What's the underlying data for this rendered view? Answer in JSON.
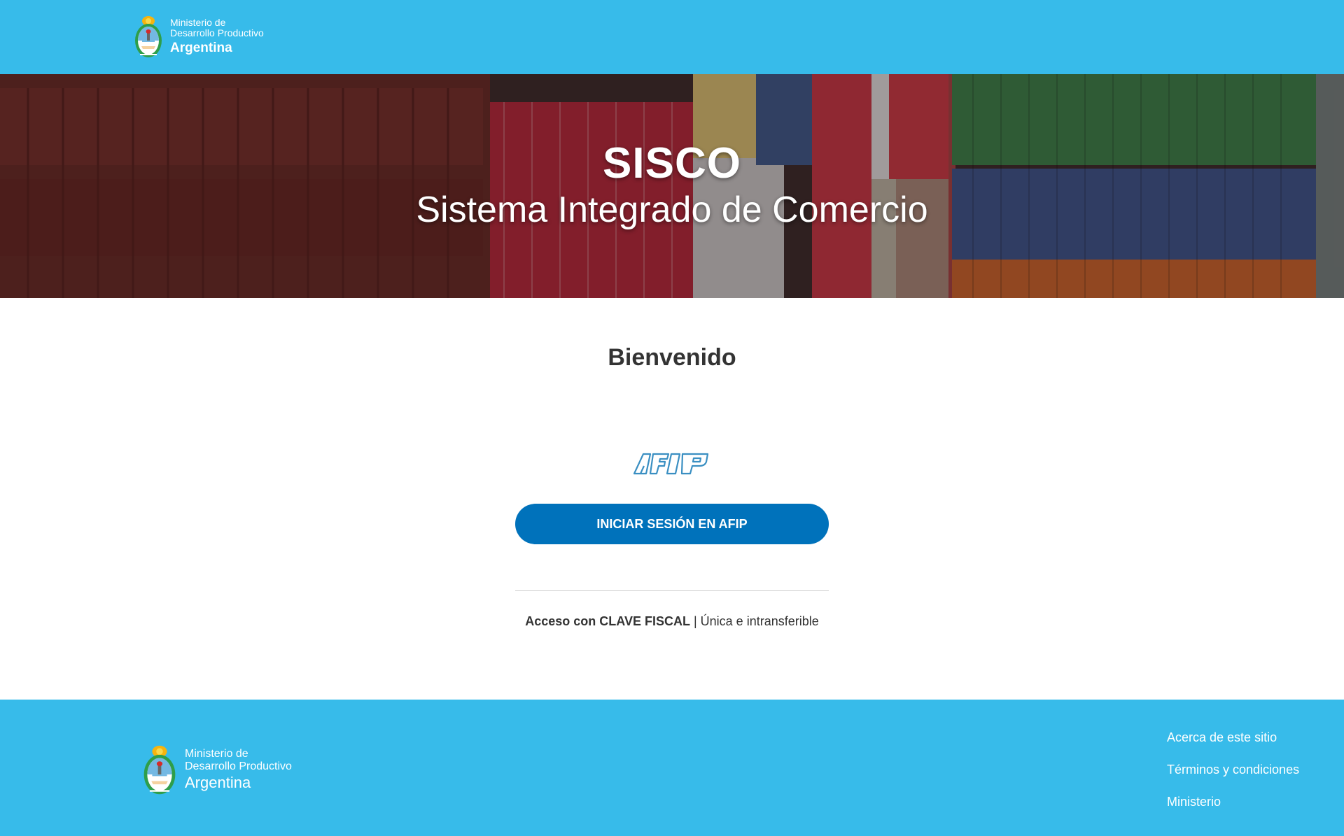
{
  "header": {
    "brand": {
      "line1": "Ministerio de",
      "line2": "Desarrollo Productivo",
      "line3": "Argentina"
    }
  },
  "hero": {
    "title": "SISCO",
    "subtitle": "Sistema Integrado de Comercio"
  },
  "main": {
    "welcome": "Bienvenido",
    "logo_label": "AFIP",
    "login_button": "INICIAR SESIÓN EN AFIP",
    "access_strong": "Acceso con CLAVE FISCAL",
    "access_separator": " | ",
    "access_rest": "Única e intransferible"
  },
  "footer": {
    "brand": {
      "line1": "Ministerio de",
      "line2": "Desarrollo Productivo",
      "line3": "Argentina"
    },
    "links": [
      {
        "label": "Acerca de este sitio"
      },
      {
        "label": "Términos y condiciones"
      },
      {
        "label": "Ministerio"
      }
    ]
  },
  "colors": {
    "header_bg": "#37bbea",
    "button_bg": "#0072bb",
    "text": "#333333"
  }
}
